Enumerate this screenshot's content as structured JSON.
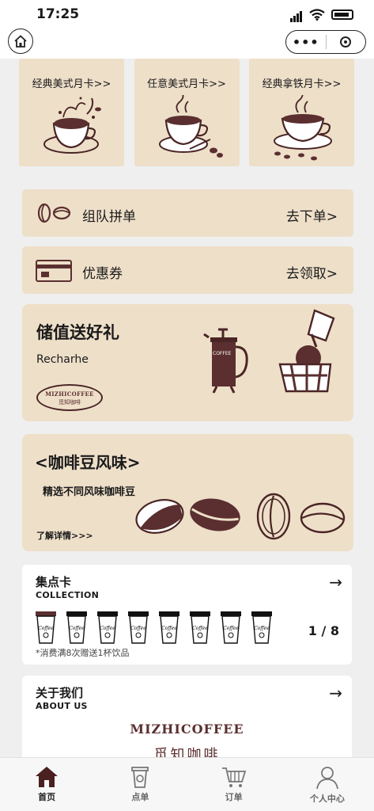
{
  "status_bar": {
    "time": "17:25"
  },
  "nav": {
    "capsule_more": "•••"
  },
  "month_cards": [
    {
      "label": "经典美式月卡>>"
    },
    {
      "label": "任意美式月卡>>"
    },
    {
      "label": "经典拿铁月卡>>"
    }
  ],
  "group_order": {
    "title": "组队拼单",
    "action": "去下单>"
  },
  "coupon": {
    "title": "优惠券",
    "action": "去领取>"
  },
  "stored_value": {
    "title": "储值送好礼",
    "subtitle": "Recharhe",
    "logo_en": "MIZHICOFFEE",
    "logo_cn": "觅知咖啡",
    "press_label": "COFFEE"
  },
  "beans": {
    "title": "<咖啡豆风味>",
    "subtitle": "精选不同风味咖啡豆",
    "more": "了解详情>>>"
  },
  "collection": {
    "title": "集点卡",
    "subtitle": "COLLECTION",
    "progress": "1 / 8",
    "progress_value": 1,
    "total": 8,
    "note": "*消费满8次赠送1杯饮品",
    "cup_label": "Coffee",
    "arrow": "→"
  },
  "about": {
    "title": "关于我们",
    "subtitle": "ABOUT US",
    "logo_en": "MIZHICOFFEE",
    "logo_cn": "觅知咖啡",
    "arrow": "→"
  },
  "tabs": [
    {
      "label": "首页",
      "icon": "home-icon",
      "active": true
    },
    {
      "label": "点单",
      "icon": "cup-icon",
      "active": false
    },
    {
      "label": "订单",
      "icon": "cart-icon",
      "active": false
    },
    {
      "label": "个人中心",
      "icon": "person-icon",
      "active": false
    }
  ],
  "colors": {
    "card_beige": "#eedfc9",
    "coffee_brown": "#5b2f2f",
    "page_bg": "#efefef"
  }
}
